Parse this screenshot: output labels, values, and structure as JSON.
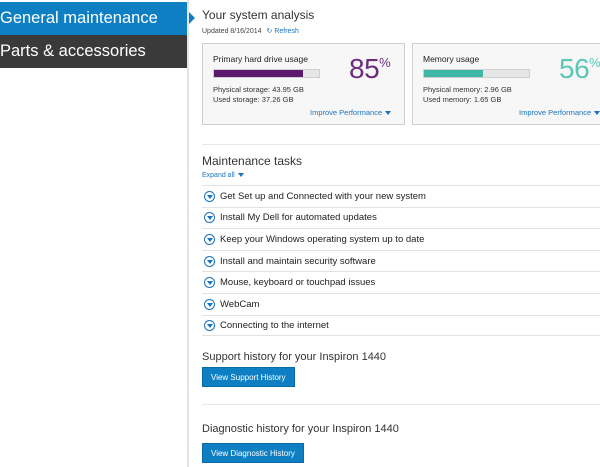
{
  "nav": {
    "items": [
      {
        "label": "General maintenance",
        "active": true
      },
      {
        "label": "Parts & accessories",
        "active": false
      }
    ]
  },
  "analysis": {
    "title": "Your system analysis",
    "updated": "Updated 8/16/2014",
    "refresh": "Refresh",
    "hard_drive": {
      "label": "Primary hard drive usage",
      "percent": "85",
      "percent_symbol": "%",
      "fill_fraction": 0.85,
      "physical": "Physical storage: 43.95 GB",
      "used": "Used storage: 37.26 GB",
      "improve": "Improve Performance"
    },
    "memory": {
      "label": "Memory usage",
      "percent": "56",
      "percent_symbol": "%",
      "fill_fraction": 0.56,
      "physical": "Physical memory: 2.96 GB",
      "used": "Used memory: 1.65 GB",
      "improve": "Improve Performance"
    }
  },
  "maintenance": {
    "title": "Maintenance tasks",
    "expand_all": "Expand all",
    "tasks": [
      "Get Set up and Connected with your new system",
      "Install My Dell for automated updates",
      "Keep your Windows operating system up to date",
      "Install and maintain security software",
      "Mouse, keyboard or touchpad issues",
      "WebCam",
      "Connecting to the internet"
    ]
  },
  "support": {
    "title": "Support history for your Inspiron 1440",
    "button": "View Support History"
  },
  "diagnostic": {
    "title": "Diagnostic history for your Inspiron 1440",
    "button": "View Diagnostic History"
  },
  "colors": {
    "nav_active": "#0e7fc3",
    "nav_inactive": "#3a3a3a",
    "hd_fill": "#5b1a6e",
    "mem_fill": "#3fb7a6",
    "link": "#1a73c0"
  }
}
